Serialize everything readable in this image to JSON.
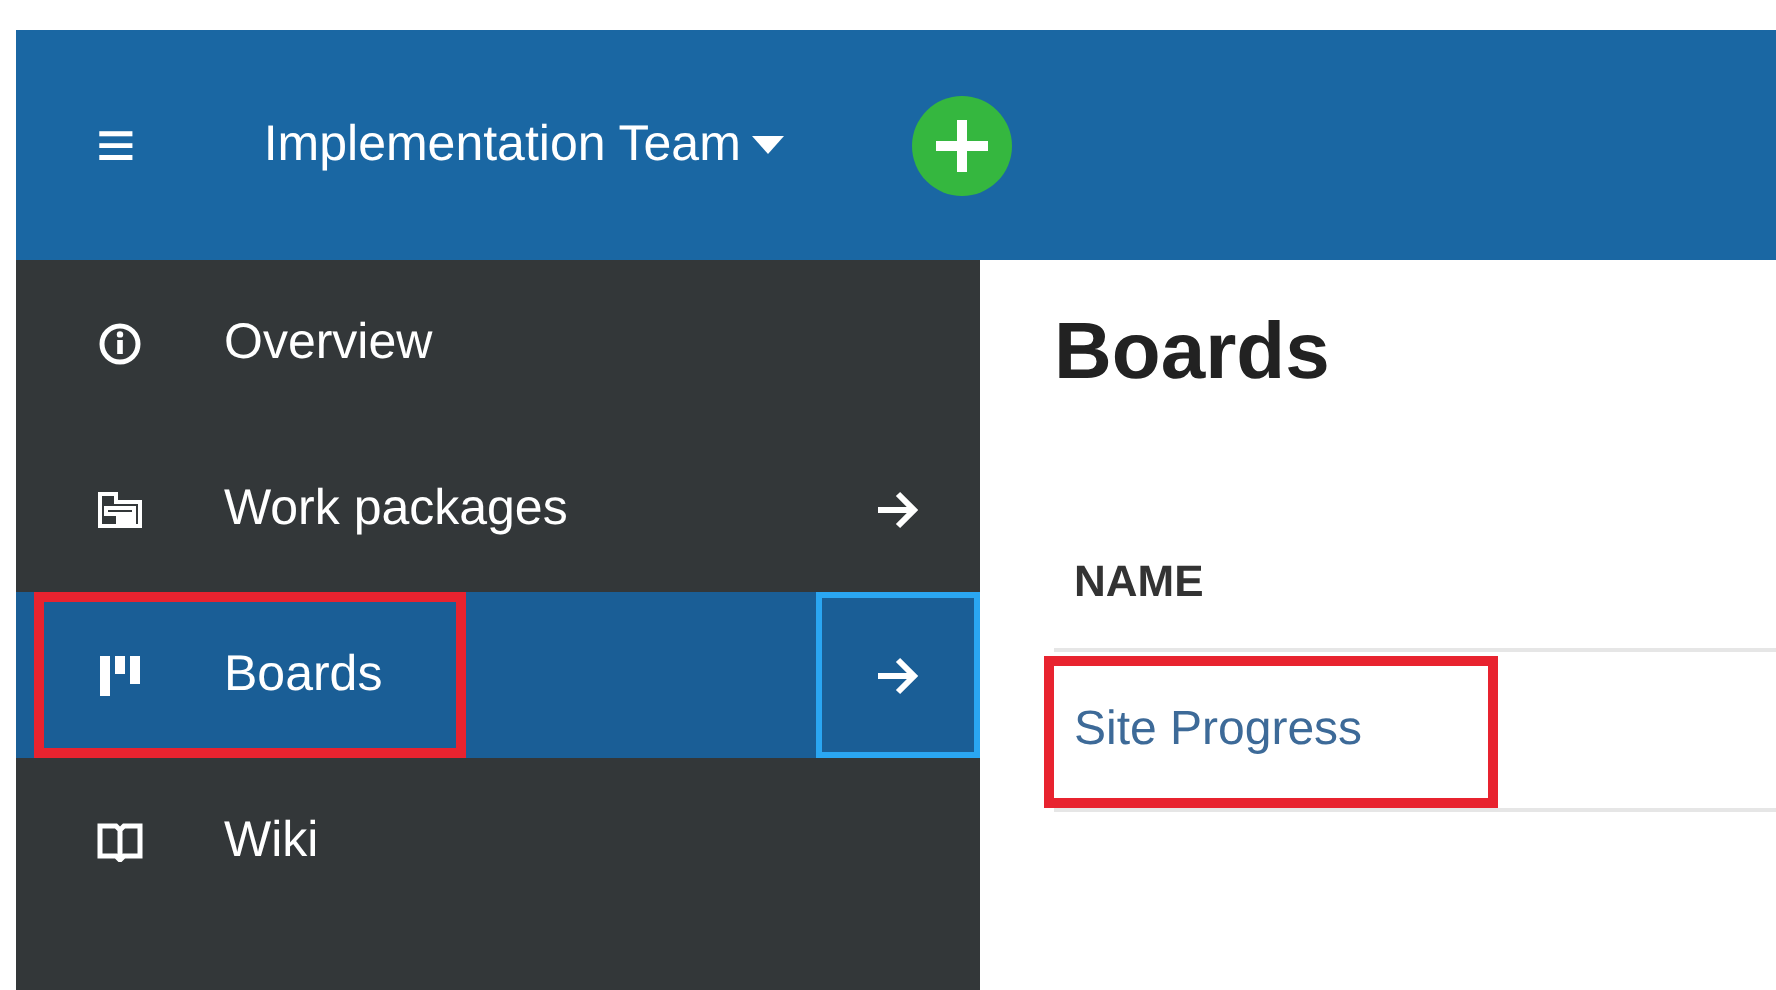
{
  "header": {
    "menu_icon": "≡",
    "project": "Implementation Team",
    "add_button": true
  },
  "sidebar": {
    "items": [
      {
        "kind": "info",
        "label": "Overview",
        "arrow": false,
        "selected": false,
        "highlighted": false
      },
      {
        "kind": "packages",
        "label": "Work packages",
        "arrow": true,
        "selected": false,
        "highlighted": false
      },
      {
        "kind": "boards",
        "label": "Boards",
        "arrow": true,
        "selected": true,
        "highlighted": true
      },
      {
        "kind": "book",
        "label": "Wiki",
        "arrow": false,
        "selected": false,
        "highlighted": false
      }
    ]
  },
  "main": {
    "title": "Boards",
    "table": {
      "columns": [
        "NAME"
      ],
      "rows": [
        {
          "name": "Site Progress",
          "highlighted": true
        }
      ]
    }
  }
}
